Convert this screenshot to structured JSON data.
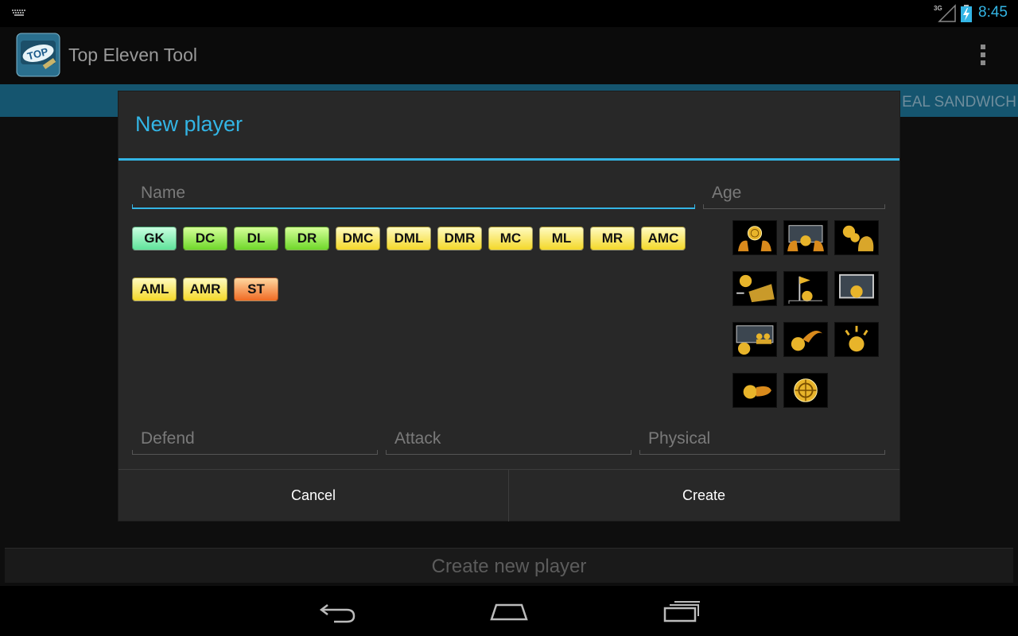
{
  "status_bar": {
    "time": "8:45",
    "network": "3G"
  },
  "app": {
    "title": "Top Eleven Tool",
    "logo_text": "TOP"
  },
  "background": {
    "tab_text": "EAL SANDWICH",
    "bottom_button": "Create new player"
  },
  "dialog": {
    "title": "New player",
    "name_placeholder": "Name",
    "age_placeholder": "Age",
    "positions": [
      "GK",
      "DC",
      "DL",
      "DR",
      "DMC",
      "DML",
      "DMR",
      "MC",
      "ML",
      "MR",
      "AMC",
      "AML",
      "AMR",
      "ST"
    ],
    "defend_placeholder": "Defend",
    "attack_placeholder": "Attack",
    "physical_placeholder": "Physical",
    "cancel_label": "Cancel",
    "create_label": "Create"
  },
  "skill_icons": [
    "glove-catch-icon",
    "goal-save-icon",
    "ball-header-icon",
    "shoe-kick-icon",
    "corner-flag-icon",
    "goal-ball-icon",
    "wall-freekick-icon",
    "curl-ball-icon",
    "ball-burst-icon",
    "fast-ball-icon",
    "target-icon"
  ],
  "colors": {
    "accent": "#33b5e5",
    "gk": "#5fe39a",
    "defender": "#6fd82a",
    "midfield": "#f4d82a",
    "striker": "#f06b24"
  }
}
